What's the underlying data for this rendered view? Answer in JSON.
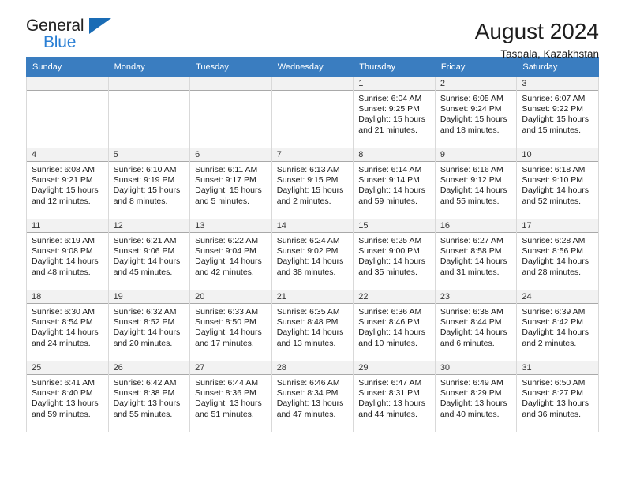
{
  "brand": {
    "name_part1": "General",
    "name_part2": "Blue",
    "flag_icon": "triangle-flag-icon"
  },
  "header": {
    "title": "August 2024",
    "subtitle": "Tasqala, Kazakhstan"
  },
  "calendar": {
    "weekday_headers": [
      "Sunday",
      "Monday",
      "Tuesday",
      "Wednesday",
      "Thursday",
      "Friday",
      "Saturday"
    ],
    "accent_color": "#3a7dc0",
    "weeks": [
      [
        {
          "day": "",
          "lines": []
        },
        {
          "day": "",
          "lines": []
        },
        {
          "day": "",
          "lines": []
        },
        {
          "day": "",
          "lines": []
        },
        {
          "day": "1",
          "lines": [
            "Sunrise: 6:04 AM",
            "Sunset: 9:25 PM",
            "Daylight: 15 hours",
            "and 21 minutes."
          ]
        },
        {
          "day": "2",
          "lines": [
            "Sunrise: 6:05 AM",
            "Sunset: 9:24 PM",
            "Daylight: 15 hours",
            "and 18 minutes."
          ]
        },
        {
          "day": "3",
          "lines": [
            "Sunrise: 6:07 AM",
            "Sunset: 9:22 PM",
            "Daylight: 15 hours",
            "and 15 minutes."
          ]
        }
      ],
      [
        {
          "day": "4",
          "lines": [
            "Sunrise: 6:08 AM",
            "Sunset: 9:21 PM",
            "Daylight: 15 hours",
            "and 12 minutes."
          ]
        },
        {
          "day": "5",
          "lines": [
            "Sunrise: 6:10 AM",
            "Sunset: 9:19 PM",
            "Daylight: 15 hours",
            "and 8 minutes."
          ]
        },
        {
          "day": "6",
          "lines": [
            "Sunrise: 6:11 AM",
            "Sunset: 9:17 PM",
            "Daylight: 15 hours",
            "and 5 minutes."
          ]
        },
        {
          "day": "7",
          "lines": [
            "Sunrise: 6:13 AM",
            "Sunset: 9:15 PM",
            "Daylight: 15 hours",
            "and 2 minutes."
          ]
        },
        {
          "day": "8",
          "lines": [
            "Sunrise: 6:14 AM",
            "Sunset: 9:14 PM",
            "Daylight: 14 hours",
            "and 59 minutes."
          ]
        },
        {
          "day": "9",
          "lines": [
            "Sunrise: 6:16 AM",
            "Sunset: 9:12 PM",
            "Daylight: 14 hours",
            "and 55 minutes."
          ]
        },
        {
          "day": "10",
          "lines": [
            "Sunrise: 6:18 AM",
            "Sunset: 9:10 PM",
            "Daylight: 14 hours",
            "and 52 minutes."
          ]
        }
      ],
      [
        {
          "day": "11",
          "lines": [
            "Sunrise: 6:19 AM",
            "Sunset: 9:08 PM",
            "Daylight: 14 hours",
            "and 48 minutes."
          ]
        },
        {
          "day": "12",
          "lines": [
            "Sunrise: 6:21 AM",
            "Sunset: 9:06 PM",
            "Daylight: 14 hours",
            "and 45 minutes."
          ]
        },
        {
          "day": "13",
          "lines": [
            "Sunrise: 6:22 AM",
            "Sunset: 9:04 PM",
            "Daylight: 14 hours",
            "and 42 minutes."
          ]
        },
        {
          "day": "14",
          "lines": [
            "Sunrise: 6:24 AM",
            "Sunset: 9:02 PM",
            "Daylight: 14 hours",
            "and 38 minutes."
          ]
        },
        {
          "day": "15",
          "lines": [
            "Sunrise: 6:25 AM",
            "Sunset: 9:00 PM",
            "Daylight: 14 hours",
            "and 35 minutes."
          ]
        },
        {
          "day": "16",
          "lines": [
            "Sunrise: 6:27 AM",
            "Sunset: 8:58 PM",
            "Daylight: 14 hours",
            "and 31 minutes."
          ]
        },
        {
          "day": "17",
          "lines": [
            "Sunrise: 6:28 AM",
            "Sunset: 8:56 PM",
            "Daylight: 14 hours",
            "and 28 minutes."
          ]
        }
      ],
      [
        {
          "day": "18",
          "lines": [
            "Sunrise: 6:30 AM",
            "Sunset: 8:54 PM",
            "Daylight: 14 hours",
            "and 24 minutes."
          ]
        },
        {
          "day": "19",
          "lines": [
            "Sunrise: 6:32 AM",
            "Sunset: 8:52 PM",
            "Daylight: 14 hours",
            "and 20 minutes."
          ]
        },
        {
          "day": "20",
          "lines": [
            "Sunrise: 6:33 AM",
            "Sunset: 8:50 PM",
            "Daylight: 14 hours",
            "and 17 minutes."
          ]
        },
        {
          "day": "21",
          "lines": [
            "Sunrise: 6:35 AM",
            "Sunset: 8:48 PM",
            "Daylight: 14 hours",
            "and 13 minutes."
          ]
        },
        {
          "day": "22",
          "lines": [
            "Sunrise: 6:36 AM",
            "Sunset: 8:46 PM",
            "Daylight: 14 hours",
            "and 10 minutes."
          ]
        },
        {
          "day": "23",
          "lines": [
            "Sunrise: 6:38 AM",
            "Sunset: 8:44 PM",
            "Daylight: 14 hours",
            "and 6 minutes."
          ]
        },
        {
          "day": "24",
          "lines": [
            "Sunrise: 6:39 AM",
            "Sunset: 8:42 PM",
            "Daylight: 14 hours",
            "and 2 minutes."
          ]
        }
      ],
      [
        {
          "day": "25",
          "lines": [
            "Sunrise: 6:41 AM",
            "Sunset: 8:40 PM",
            "Daylight: 13 hours",
            "and 59 minutes."
          ]
        },
        {
          "day": "26",
          "lines": [
            "Sunrise: 6:42 AM",
            "Sunset: 8:38 PM",
            "Daylight: 13 hours",
            "and 55 minutes."
          ]
        },
        {
          "day": "27",
          "lines": [
            "Sunrise: 6:44 AM",
            "Sunset: 8:36 PM",
            "Daylight: 13 hours",
            "and 51 minutes."
          ]
        },
        {
          "day": "28",
          "lines": [
            "Sunrise: 6:46 AM",
            "Sunset: 8:34 PM",
            "Daylight: 13 hours",
            "and 47 minutes."
          ]
        },
        {
          "day": "29",
          "lines": [
            "Sunrise: 6:47 AM",
            "Sunset: 8:31 PM",
            "Daylight: 13 hours",
            "and 44 minutes."
          ]
        },
        {
          "day": "30",
          "lines": [
            "Sunrise: 6:49 AM",
            "Sunset: 8:29 PM",
            "Daylight: 13 hours",
            "and 40 minutes."
          ]
        },
        {
          "day": "31",
          "lines": [
            "Sunrise: 6:50 AM",
            "Sunset: 8:27 PM",
            "Daylight: 13 hours",
            "and 36 minutes."
          ]
        }
      ]
    ]
  }
}
